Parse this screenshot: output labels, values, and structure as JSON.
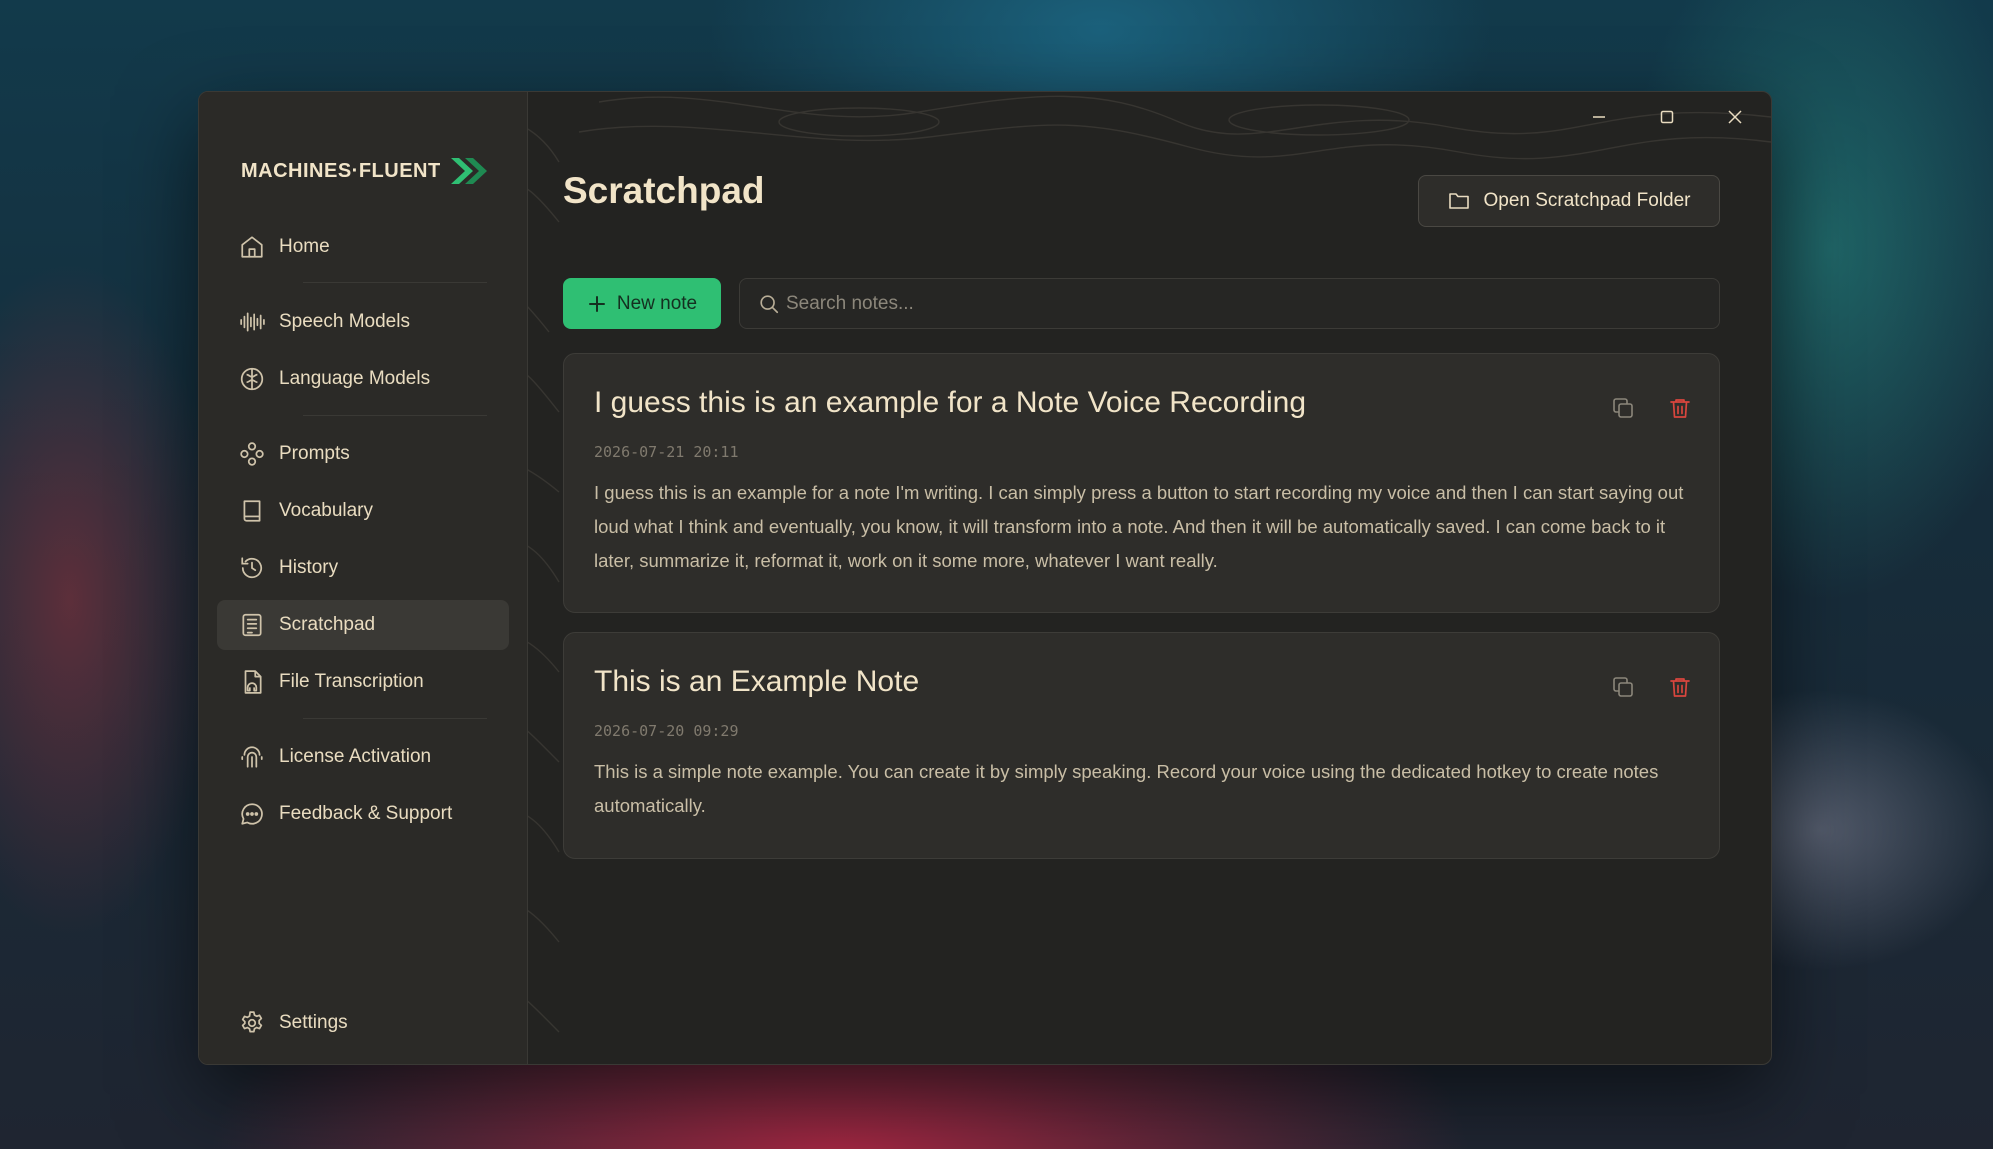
{
  "brand": {
    "name": "MACHINES·FLUENT"
  },
  "sidebar": {
    "items": [
      {
        "label": "Home",
        "icon": "home-icon"
      },
      {
        "label": "Speech Models",
        "icon": "waveform-icon"
      },
      {
        "label": "Language Models",
        "icon": "brain-icon"
      },
      {
        "label": "Prompts",
        "icon": "prompts-icon"
      },
      {
        "label": "Vocabulary",
        "icon": "book-icon"
      },
      {
        "label": "History",
        "icon": "history-icon"
      },
      {
        "label": "Scratchpad",
        "icon": "notes-icon",
        "active": true
      },
      {
        "label": "File Transcription",
        "icon": "file-audio-icon"
      },
      {
        "label": "License Activation",
        "icon": "fingerprint-icon"
      },
      {
        "label": "Feedback & Support",
        "icon": "chat-icon"
      }
    ],
    "settings_label": "Settings"
  },
  "main": {
    "title": "Scratchpad",
    "open_folder_label": "Open Scratchpad Folder",
    "new_note_label": "New note",
    "search_placeholder": "Search notes...",
    "notes": [
      {
        "title": "I guess this is an example for a Note Voice Recording",
        "date": "2026-07-21 20:11",
        "body": "I guess this is an example for a note I'm writing. I can simply press a button to start recording my voice and then I can start saying out loud what I think and eventually, you know, it will transform into a note. And then it will be automatically saved. I can come back to it later, summarize it, reformat it, work on it some more, whatever I want really."
      },
      {
        "title": "This is an Example Note",
        "date": "2026-07-20 09:29",
        "body": "This is a simple note example. You can create it by simply speaking. Record your voice using the dedicated hotkey to create notes automatically."
      }
    ]
  },
  "colors": {
    "accent": "#2fbf73",
    "delete": "#d9463e",
    "text": "#f1e4c8",
    "background": "#232321"
  }
}
